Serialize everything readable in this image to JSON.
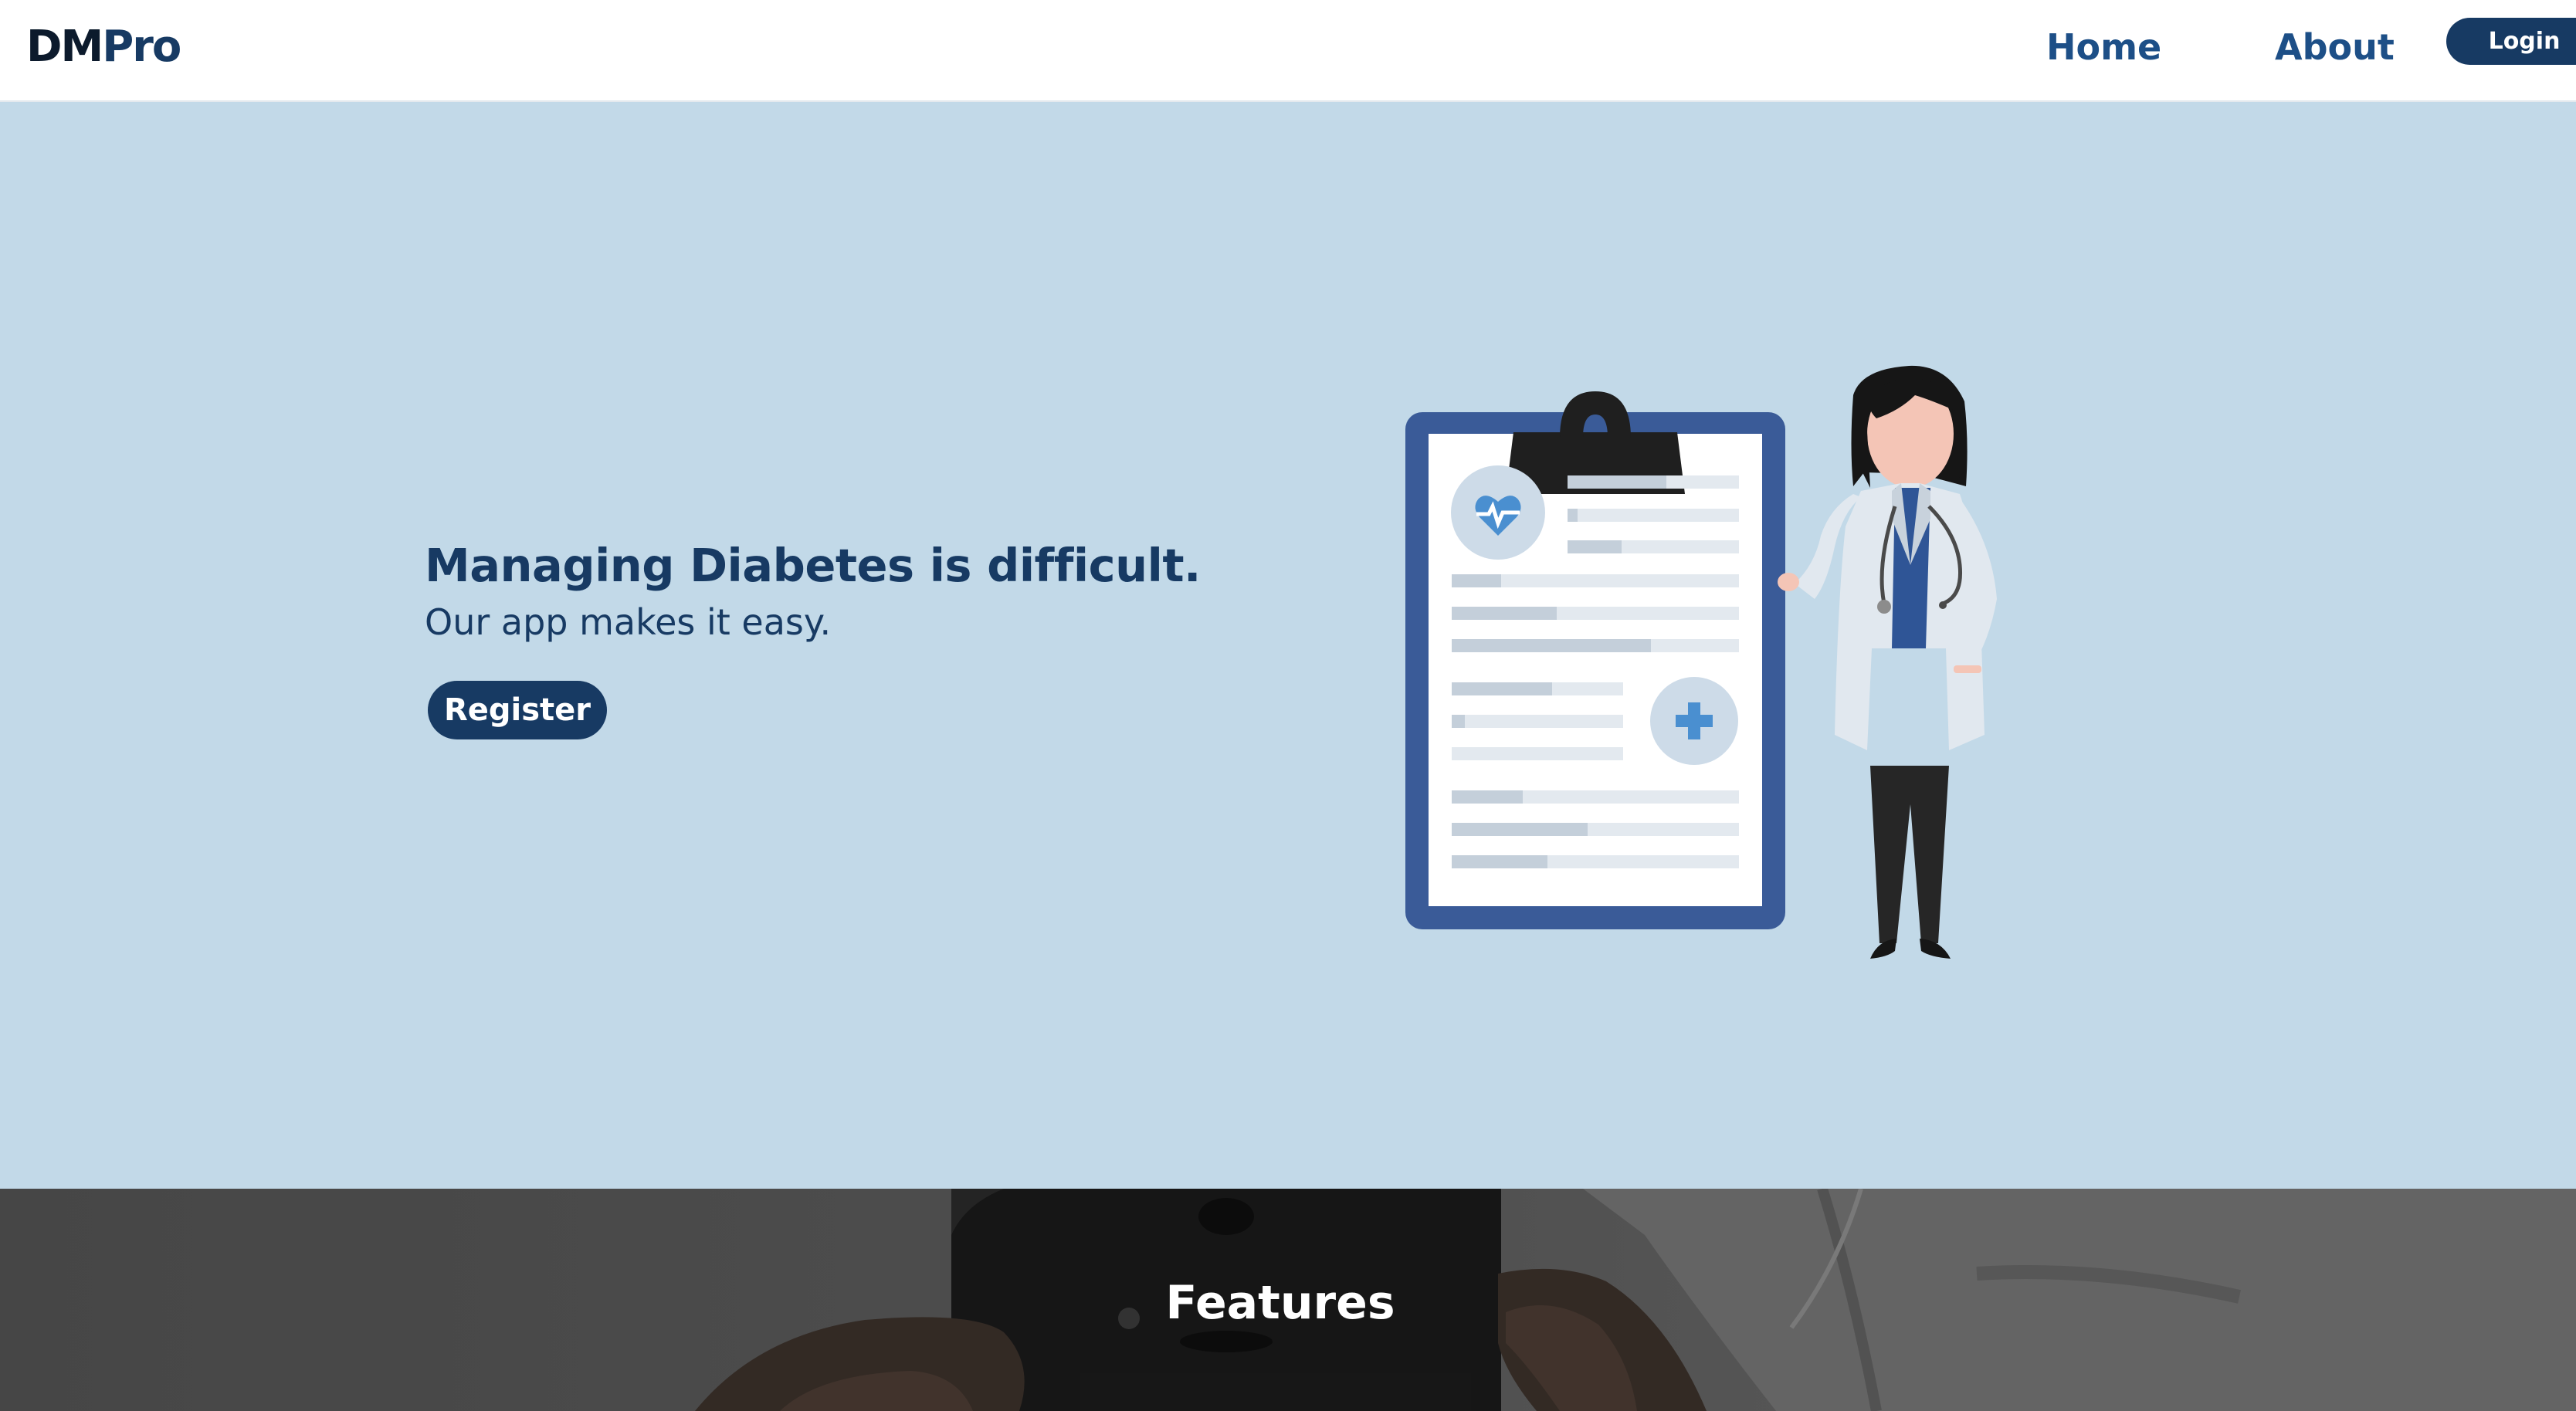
{
  "header": {
    "logo_primary": "DM",
    "logo_secondary": "Pro",
    "nav": [
      {
        "label": "Home"
      },
      {
        "label": "About"
      }
    ],
    "login_label": "Login"
  },
  "hero": {
    "title": "Managing Diabetes is difficult.",
    "subtitle": "Our app makes it easy.",
    "register_label": "Register",
    "illustration_icons": [
      "clipboard-icon",
      "heart-pulse-icon",
      "plus-icon",
      "doctor-figure"
    ]
  },
  "features": {
    "title": "Features"
  },
  "colors": {
    "brand_dark": "#173a63",
    "brand_link": "#1d4f87",
    "hero_background": "#c2d9e8",
    "clipboard_frame": "#3a5b98",
    "icon_blue": "#4a8fd0"
  }
}
